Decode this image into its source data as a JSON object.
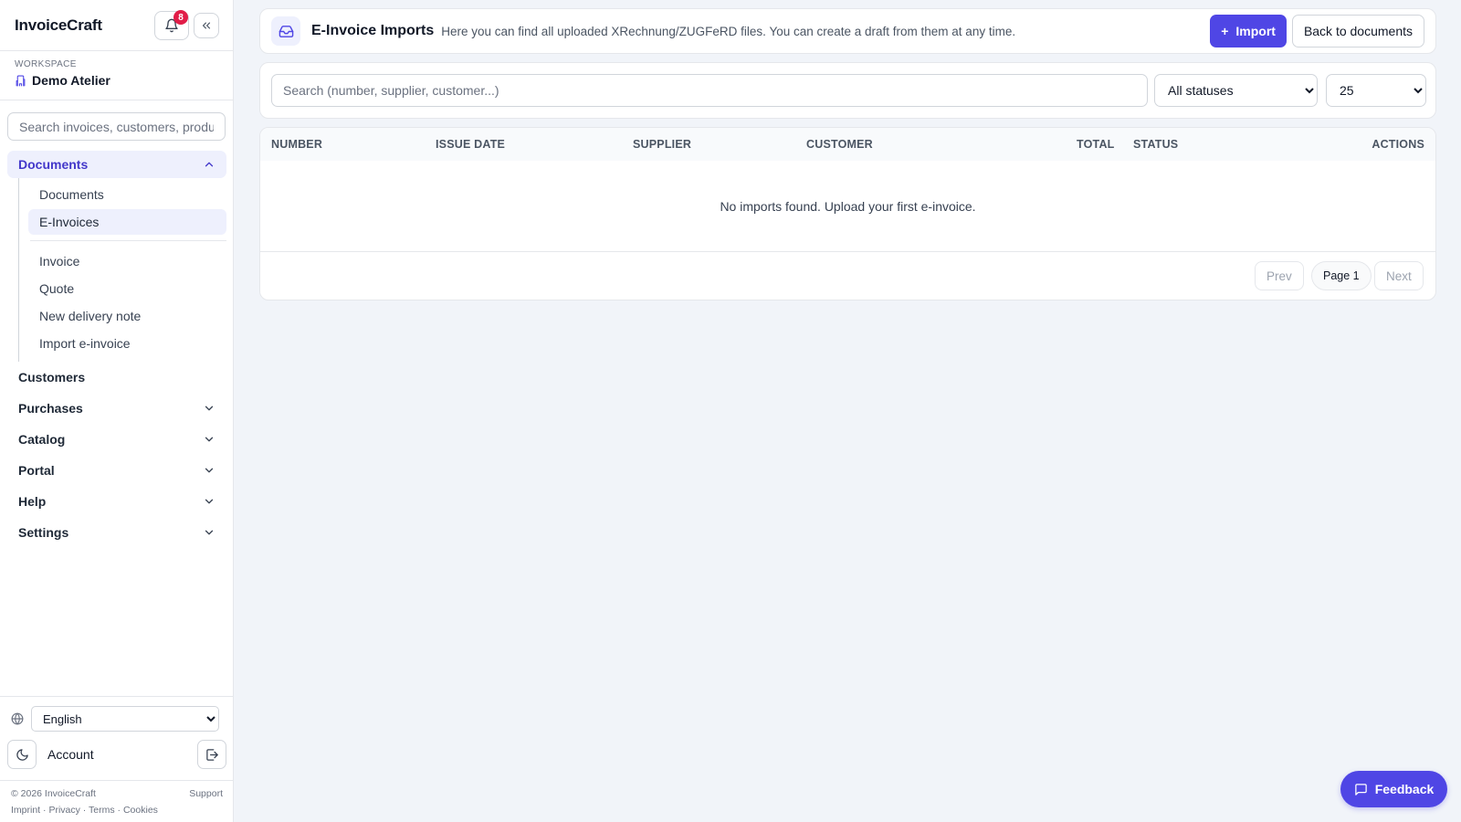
{
  "app": {
    "brand": "InvoiceCraft",
    "notification_count": "8"
  },
  "workspace": {
    "label": "WORKSPACE",
    "name": "Demo Atelier"
  },
  "sidebar": {
    "search_placeholder": "Search invoices, customers, products...",
    "documents_group": {
      "label": "Documents",
      "items": [
        {
          "label": "Documents"
        },
        {
          "label": "E-Invoices"
        }
      ],
      "create_items": [
        {
          "label": "Invoice"
        },
        {
          "label": "Quote"
        },
        {
          "label": "New delivery note"
        },
        {
          "label": "Import e-invoice"
        }
      ]
    },
    "nav_items": [
      {
        "label": "Customers"
      },
      {
        "label": "Purchases"
      },
      {
        "label": "Catalog"
      },
      {
        "label": "Portal"
      },
      {
        "label": "Help"
      },
      {
        "label": "Settings"
      }
    ],
    "language": "English",
    "account_label": "Account",
    "footer": {
      "copyright": "© 2026 InvoiceCraft",
      "support": "Support",
      "imprint": "Imprint",
      "privacy": "Privacy",
      "terms": "Terms",
      "cookies": "Cookies",
      "separator": "·"
    }
  },
  "header": {
    "title": "E-Invoice Imports",
    "description": "Here you can find all uploaded XRechnung/ZUGFeRD files. You can create a draft from them at any time.",
    "import_label": "Import",
    "import_plus": "+",
    "back_label": "Back to documents"
  },
  "filters": {
    "search_placeholder": "Search (number, supplier, customer...)",
    "status_selected": "All statuses",
    "per_page_selected": "25"
  },
  "table": {
    "columns": {
      "number": "NUMBER",
      "issue_date": "ISSUE DATE",
      "supplier": "SUPPLIER",
      "customer": "CUSTOMER",
      "total": "TOTAL",
      "status": "STATUS",
      "actions": "ACTIONS"
    },
    "empty_message": "No imports found. Upload your first e-invoice."
  },
  "pagination": {
    "prev": "Prev",
    "page": "Page 1",
    "next": "Next"
  },
  "feedback_label": "Feedback",
  "colors": {
    "accent": "#4f46e5",
    "badge": "#e11d48",
    "active_bg": "#eef0fd"
  }
}
